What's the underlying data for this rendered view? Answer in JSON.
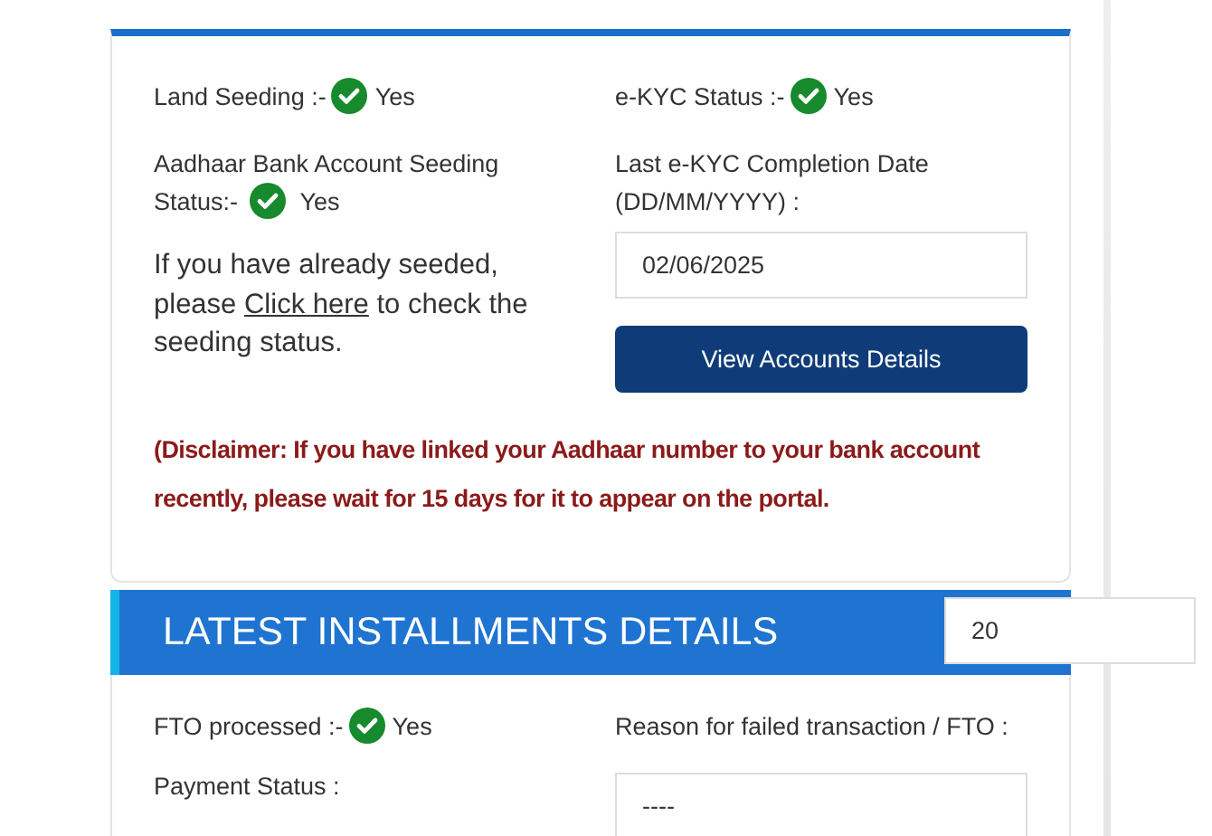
{
  "seeding_card": {
    "statuses": [
      {
        "label": "Land Seeding :-",
        "checked": true,
        "value": "Yes"
      },
      {
        "label": "e-KYC Status :-",
        "checked": true,
        "value": "Yes"
      }
    ],
    "bank_seeding": {
      "label": "Aadhaar Bank Account Seeding Status:-",
      "checked": true,
      "value": "Yes"
    },
    "ekyc_date": {
      "label": "Last e-KYC Completion Date (DD/MM/YYYY) :",
      "value": "02/06/2025"
    },
    "seeded_note": {
      "before": "If you have already seeded, please",
      "link": "Click here",
      "after": "to check the seeding status."
    },
    "button": "View Accounts Details",
    "disclaimer": "(Disclaimer: If you have linked your Aadhaar number to your bank account recently, please wait for 15 days for it to appear on the portal."
  },
  "installments": {
    "title": "LATEST INSTALLMENTS DETAILS",
    "installment_field": "20",
    "fto": {
      "label": "FTO processed :-",
      "checked": true,
      "value": "Yes"
    },
    "reason": {
      "label": "Reason for failed transaction / FTO :",
      "value": "----"
    },
    "payment_status": {
      "label": "Payment Status :"
    }
  }
}
